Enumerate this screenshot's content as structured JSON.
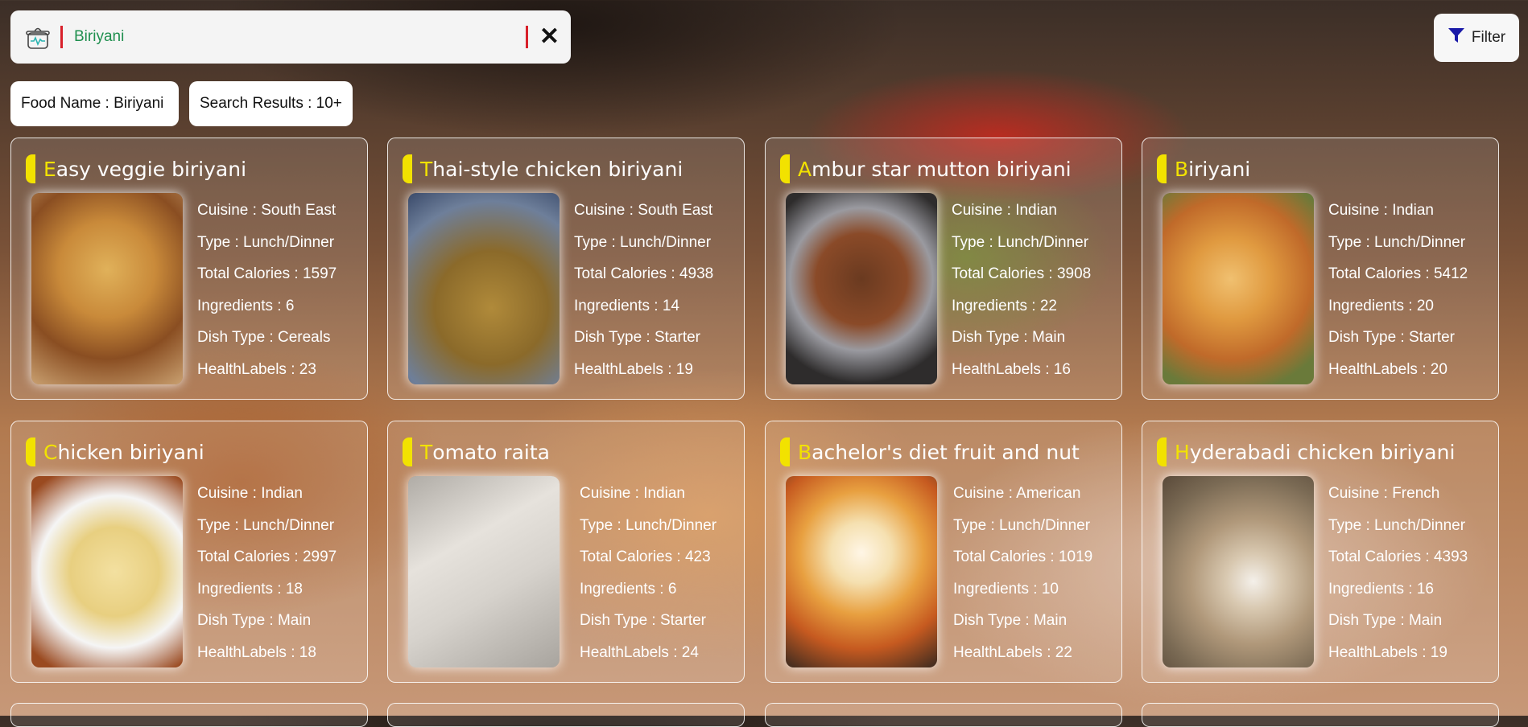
{
  "search": {
    "value": "Biriyani",
    "clear_label": "✕"
  },
  "filter": {
    "label": "Filter",
    "icon": "filter-icon"
  },
  "chips": {
    "food_name": "Food Name : Biriyani",
    "results": "Search Results : 10+"
  },
  "colors": {
    "accent_yellow": "#f2e200",
    "search_text": "#1f8f4e",
    "red_bar": "#d8202a",
    "filter_icon": "#1a1aa8"
  },
  "cards": [
    {
      "first": "E",
      "rest": "asy veggie biriyani",
      "cuisine": "Cuisine : South East",
      "type": "Type : Lunch/Dinner",
      "calories": "Total Calories : 1597",
      "ingredients": "Ingredients : 6",
      "dish": "Dish Type : Cereals",
      "health": "HealthLabels : 23"
    },
    {
      "first": "T",
      "rest": "hai-style chicken biriyani",
      "cuisine": "Cuisine : South East",
      "type": "Type : Lunch/Dinner",
      "calories": "Total Calories : 4938",
      "ingredients": "Ingredients : 14",
      "dish": "Dish Type : Starter",
      "health": "HealthLabels : 19"
    },
    {
      "first": "A",
      "rest": "mbur star mutton biriyani",
      "cuisine": "Cuisine : Indian",
      "type": "Type : Lunch/Dinner",
      "calories": "Total Calories : 3908",
      "ingredients": "Ingredients : 22",
      "dish": "Dish Type : Main",
      "health": "HealthLabels : 16"
    },
    {
      "first": "B",
      "rest": "iriyani",
      "cuisine": "Cuisine : Indian",
      "type": "Type : Lunch/Dinner",
      "calories": "Total Calories : 5412",
      "ingredients": "Ingredients : 20",
      "dish": "Dish Type : Starter",
      "health": "HealthLabels : 20"
    },
    {
      "first": "C",
      "rest": "hicken biriyani",
      "cuisine": "Cuisine : Indian",
      "type": "Type : Lunch/Dinner",
      "calories": "Total Calories : 2997",
      "ingredients": "Ingredients : 18",
      "dish": "Dish Type : Main",
      "health": "HealthLabels : 18"
    },
    {
      "first": "T",
      "rest": "omato raita",
      "cuisine": "Cuisine : Indian",
      "type": "Type : Lunch/Dinner",
      "calories": "Total Calories : 423",
      "ingredients": "Ingredients : 6",
      "dish": "Dish Type : Starter",
      "health": "HealthLabels : 24"
    },
    {
      "first": "B",
      "rest": "achelor's diet fruit and nut",
      "cuisine": "Cuisine : American",
      "type": "Type : Lunch/Dinner",
      "calories": "Total Calories : 1019",
      "ingredients": "Ingredients : 10",
      "dish": "Dish Type : Main",
      "health": "HealthLabels : 22"
    },
    {
      "first": "H",
      "rest": "yderabadi chicken biriyani",
      "cuisine": "Cuisine : French",
      "type": "Type : Lunch/Dinner",
      "calories": "Total Calories : 4393",
      "ingredients": "Ingredients : 16",
      "dish": "Dish Type : Main",
      "health": "HealthLabels : 19"
    }
  ]
}
